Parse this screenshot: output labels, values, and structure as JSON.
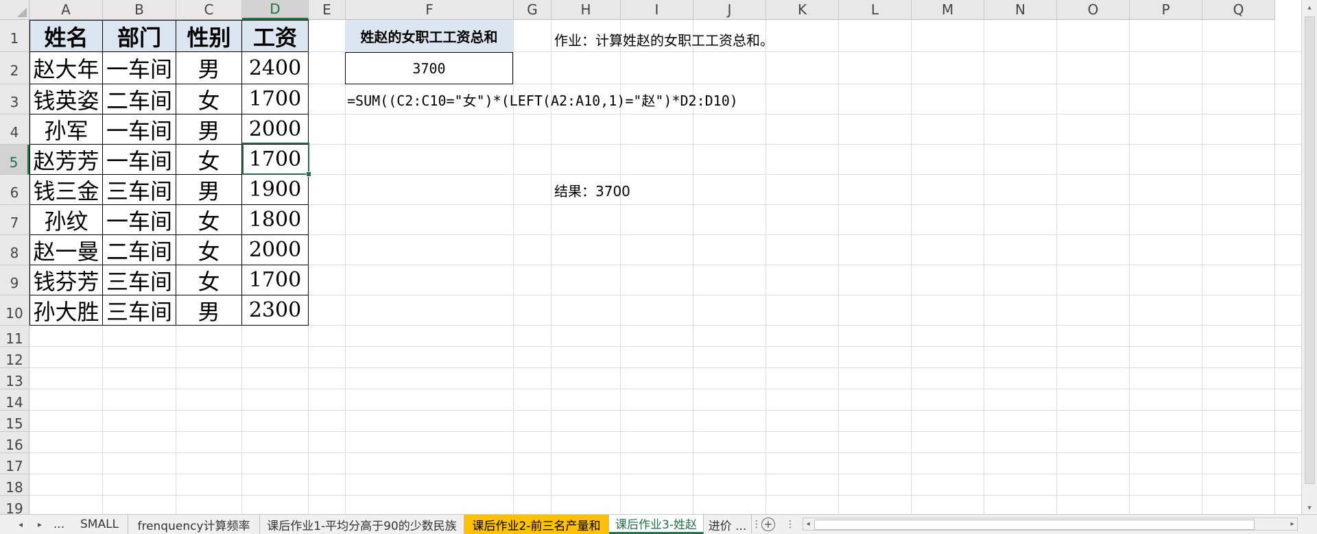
{
  "columns": [
    "A",
    "B",
    "C",
    "D",
    "E",
    "F",
    "G",
    "H",
    "I",
    "J",
    "K",
    "L",
    "M",
    "N",
    "O",
    "P",
    "Q"
  ],
  "rows": [
    "1",
    "2",
    "3",
    "4",
    "5",
    "6",
    "7",
    "8",
    "9",
    "10",
    "11",
    "12",
    "13",
    "14",
    "15",
    "16",
    "17",
    "18",
    "19"
  ],
  "selected_cell": "D5",
  "table": {
    "headers": [
      "姓名",
      "部门",
      "性别",
      "工资"
    ],
    "rows": [
      [
        "赵大年",
        "一车间",
        "男",
        "2400"
      ],
      [
        "钱英姿",
        "二车间",
        "女",
        "1700"
      ],
      [
        "孙军",
        "一车间",
        "男",
        "2000"
      ],
      [
        "赵芳芳",
        "一车间",
        "女",
        "1700"
      ],
      [
        "钱三金",
        "三车间",
        "男",
        "1900"
      ],
      [
        "孙纹",
        "一车间",
        "女",
        "1800"
      ],
      [
        "赵一曼",
        "二车间",
        "女",
        "2000"
      ],
      [
        "钱芬芳",
        "三车间",
        "女",
        "1700"
      ],
      [
        "孙大胜",
        "三车间",
        "男",
        "2300"
      ]
    ]
  },
  "summary": {
    "label": "姓赵的女职工工资总和",
    "value": "3700",
    "formula": "=SUM((C2:C10=\"女\")*(LEFT(A2:A10,1)=\"赵\")*D2:D10)",
    "task": "作业：计算姓赵的女职工工资总和。",
    "result": "结果：3700"
  },
  "sheet_tabs": [
    {
      "label": "...",
      "state": "normal"
    },
    {
      "label": "SMALL",
      "state": "normal"
    },
    {
      "label": "frenquency计算频率",
      "state": "normal"
    },
    {
      "label": "课后作业1-平均分高于90的少数民族",
      "state": "normal"
    },
    {
      "label": "课后作业2-前三名产量和",
      "state": "orange"
    },
    {
      "label": "课后作业3-姓赵",
      "state": "active"
    },
    {
      "label": "进价 ...",
      "state": "normal"
    }
  ],
  "colors": {
    "accent": "#217346",
    "header_fill": "#dce6f1",
    "tab_orange": "#ffc000"
  },
  "icons": {
    "nav_prev": "◂",
    "nav_next": "▸",
    "add_sheet": "+",
    "scroll_up": "▴",
    "scroll_down": "▾",
    "scroll_left": "◂",
    "scroll_right": "▸"
  }
}
